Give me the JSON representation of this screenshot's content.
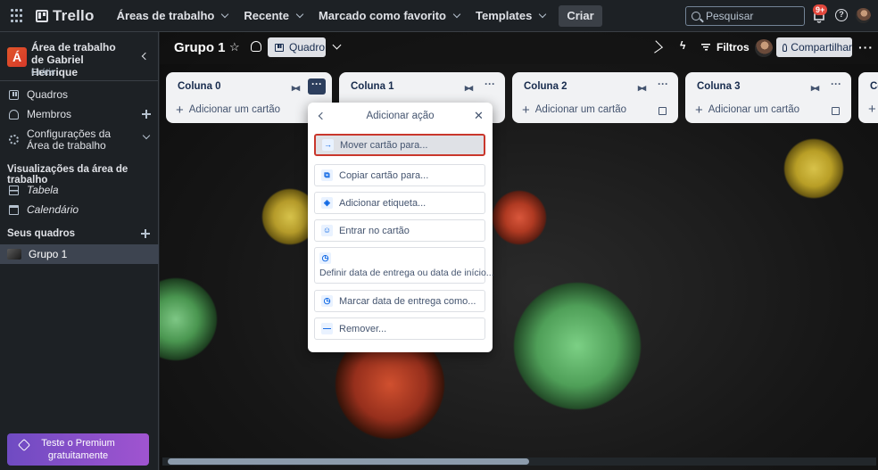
{
  "topbar": {
    "app_name": "Trello",
    "menu": [
      {
        "label": "Áreas de trabalho"
      },
      {
        "label": "Recente"
      },
      {
        "label": "Marcado como favorito"
      },
      {
        "label": "Templates"
      }
    ],
    "create_label": "Criar",
    "search_placeholder": "Pesquisar",
    "notification_badge": "9+",
    "help_glyph": "?"
  },
  "sidebar": {
    "workspace_initial": "Á",
    "workspace_name": "Área de trabalho de Gabriel Henrique",
    "workspace_plan": "Grátis",
    "items": [
      {
        "label": "Quadros"
      },
      {
        "label": "Membros"
      },
      {
        "label": "Configurações da Área de trabalho"
      }
    ],
    "views_heading": "Visualizações da área de trabalho",
    "views": [
      {
        "label": "Tabela"
      },
      {
        "label": "Calendário"
      }
    ],
    "boards_heading": "Seus quadros",
    "boards": [
      {
        "label": "Grupo 1"
      }
    ],
    "premium_label": "Teste o Premium gratuitamente"
  },
  "board": {
    "title": "Grupo 1",
    "view_label": "Quadro",
    "filter_label": "Filtros",
    "share_label": "Compartilhar",
    "lists": [
      {
        "title": "Coluna 0",
        "add_label": "Adicionar um cartão"
      },
      {
        "title": "Coluna 1",
        "add_label": "Adicionar um cartão"
      },
      {
        "title": "Coluna 2",
        "add_label": "Adicionar um cartão"
      },
      {
        "title": "Coluna 3",
        "add_label": "Adicionar um cartão"
      },
      {
        "title": "Co",
        "add_label": ""
      }
    ]
  },
  "popover": {
    "title": "Adicionar ação",
    "actions": [
      {
        "label": "Mover cartão para...",
        "icon": "arrow-right-icon",
        "glyph": "→"
      },
      {
        "label": "Copiar cartão para...",
        "icon": "copy-icon",
        "glyph": "⧉"
      },
      {
        "label": "Adicionar etiqueta...",
        "icon": "tag-icon",
        "glyph": "◈"
      },
      {
        "label": "Entrar no cartão",
        "icon": "person-icon",
        "glyph": "☺"
      },
      {
        "label": "Definir data de entrega ou data de início...",
        "icon": "clock-icon",
        "glyph": "◷"
      },
      {
        "label": "Marcar data de entrega como...",
        "icon": "clock-icon",
        "glyph": "◷"
      },
      {
        "label": "Remover...",
        "icon": "minus-icon",
        "glyph": "—"
      }
    ]
  },
  "colors": {
    "accent_red": "#c9372c",
    "premium_gradient_start": "#6f4bc2",
    "premium_gradient_end": "#a054d0",
    "list_bg": "#f1f2f4"
  }
}
